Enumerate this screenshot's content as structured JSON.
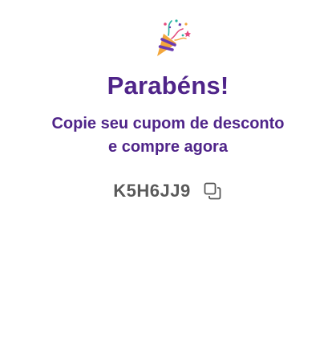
{
  "success": {
    "icon": "party-popper-icon",
    "title": "Parabéns!",
    "subtitle": "Copie seu cupom de desconto e compre agora",
    "coupon_code": "K5H6JJ9",
    "copy_icon": "copy-icon"
  },
  "colors": {
    "primary": "#4f2489",
    "code_text": "#5a5a5a",
    "background": "#ffffff"
  }
}
